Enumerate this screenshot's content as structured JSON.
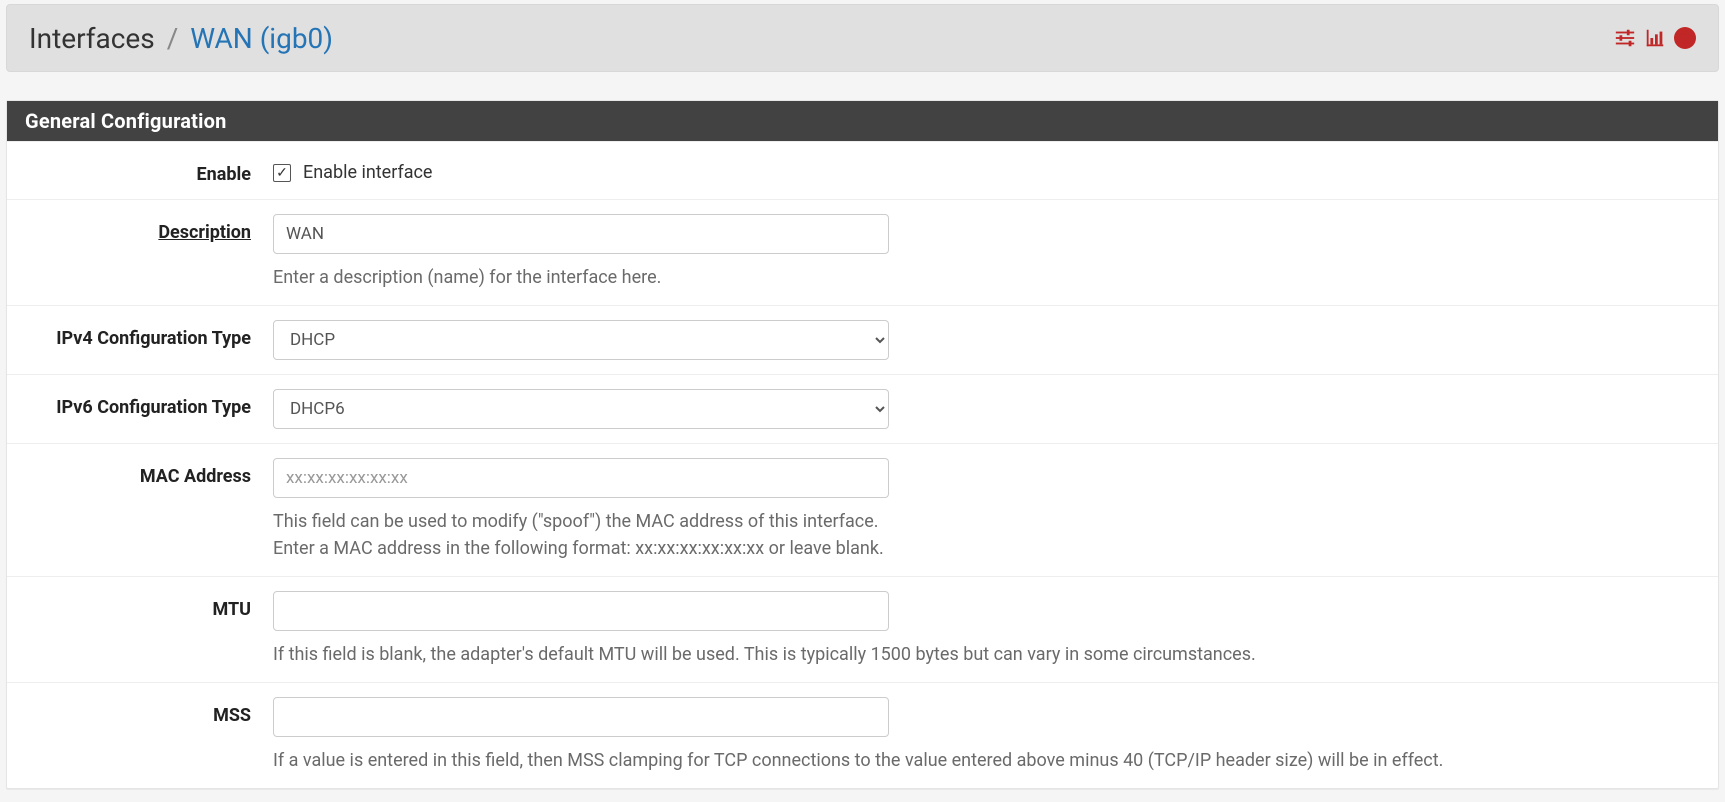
{
  "breadcrumb": {
    "root": "Interfaces",
    "sep": "/",
    "current": "WAN (igb0)"
  },
  "panel": {
    "heading": "General Configuration"
  },
  "fields": {
    "enable": {
      "label": "Enable",
      "checkbox_label": "Enable interface",
      "checked": true
    },
    "description": {
      "label": "Description",
      "value": "WAN",
      "help": "Enter a description (name) for the interface here."
    },
    "ipv4type": {
      "label": "IPv4 Configuration Type",
      "value": "DHCP"
    },
    "ipv6type": {
      "label": "IPv6 Configuration Type",
      "value": "DHCP6"
    },
    "mac": {
      "label": "MAC Address",
      "placeholder": "xx:xx:xx:xx:xx:xx",
      "value": "",
      "help_line1": "This field can be used to modify (\"spoof\") the MAC address of this interface.",
      "help_line2": "Enter a MAC address in the following format: xx:xx:xx:xx:xx:xx or leave blank."
    },
    "mtu": {
      "label": "MTU",
      "value": "",
      "help": "If this field is blank, the adapter's default MTU will be used. This is typically 1500 bytes but can vary in some circumstances."
    },
    "mss": {
      "label": "MSS",
      "value": "",
      "help": "If a value is entered in this field, then MSS clamping for TCP connections to the value entered above minus 40 (TCP/IP header size) will be in effect."
    }
  }
}
